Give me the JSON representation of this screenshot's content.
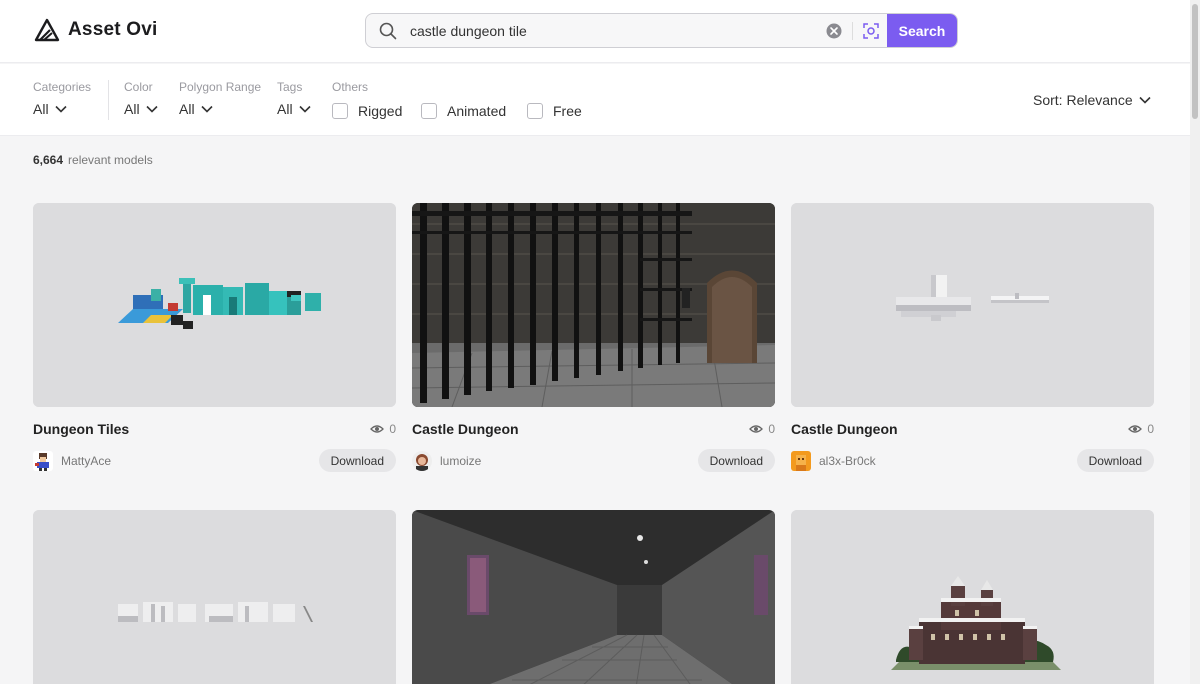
{
  "app": {
    "name": "Asset Ovi"
  },
  "search": {
    "query": "castle dungeon tile",
    "button_label": "Search"
  },
  "filters": {
    "categories": {
      "label": "Categories",
      "value": "All"
    },
    "color": {
      "label": "Color",
      "value": "All"
    },
    "polygon_range": {
      "label": "Polygon Range",
      "value": "All"
    },
    "tags": {
      "label": "Tags",
      "value": "All"
    },
    "others": {
      "label": "Others"
    },
    "checkboxes": [
      {
        "label": "Rigged",
        "checked": false
      },
      {
        "label": "Animated",
        "checked": false
      },
      {
        "label": "Free",
        "checked": false
      }
    ],
    "sort": "Sort: Relevance"
  },
  "results": {
    "count": "6,664",
    "label": "relevant models"
  },
  "models": [
    {
      "title": "Dungeon Tiles",
      "views": "0",
      "author": "MattyAce",
      "download_label": "Download"
    },
    {
      "title": "Castle Dungeon",
      "views": "0",
      "author": "lumoize",
      "download_label": "Download"
    },
    {
      "title": "Castle Dungeon",
      "views": "0",
      "author": "al3x-Br0ck",
      "download_label": "Download"
    },
    {
      "title": "",
      "views": "",
      "author": "",
      "download_label": ""
    },
    {
      "title": "",
      "views": "",
      "author": "",
      "download_label": ""
    },
    {
      "title": "",
      "views": "",
      "author": "",
      "download_label": ""
    }
  ],
  "colors": {
    "accent": "#7b5cf0",
    "thumb_bg": "#dcdcde"
  }
}
